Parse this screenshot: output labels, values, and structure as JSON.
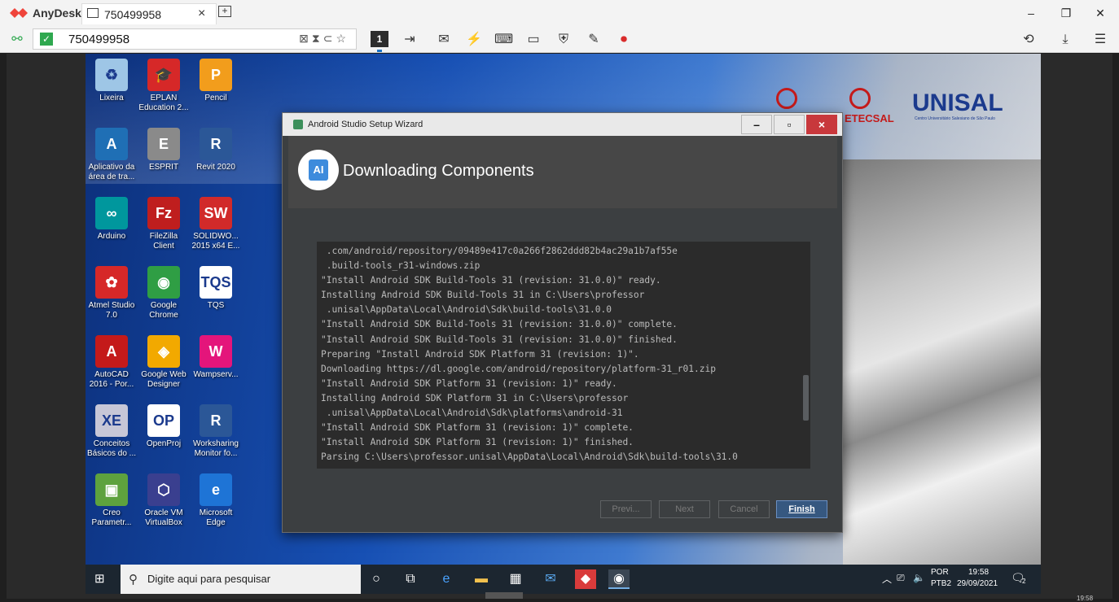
{
  "anydesk": {
    "app_name": "AnyDesk",
    "tab_label": "750499958",
    "tab_close": "×",
    "address_value": "750499958",
    "session_number": "1",
    "window_controls": [
      "–",
      "❐",
      "✕"
    ]
  },
  "desktop_icons": [
    {
      "label": "Lixeira",
      "icon": "recycle-bin-icon",
      "glyph": "♻",
      "color": "#9ec6e6"
    },
    {
      "label": "EPLAN\nEducation 2...",
      "icon": "eplan-icon",
      "glyph": "🎓",
      "color": "#d62828"
    },
    {
      "label": "Pencil",
      "icon": "pencil-icon",
      "glyph": "P",
      "color": "#f29d1c"
    },
    {
      "label": "Aplicativo da\nárea de tra...",
      "icon": "autodesk-app-icon",
      "glyph": "A",
      "color": "#1f6fb5"
    },
    {
      "label": "ESPRIT",
      "icon": "esprit-icon",
      "glyph": "E",
      "color": "#8a8a8a"
    },
    {
      "label": "Revit 2020",
      "icon": "revit-icon",
      "glyph": "R",
      "color": "#2b5797"
    },
    {
      "label": "Arduino",
      "icon": "arduino-icon",
      "glyph": "∞",
      "color": "#00979d"
    },
    {
      "label": "FileZilla\nClient",
      "icon": "filezilla-icon",
      "glyph": "Fz",
      "color": "#bf1e1e"
    },
    {
      "label": "SOLIDWO...\n2015 x64 E...",
      "icon": "solidworks-icon",
      "glyph": "SW",
      "color": "#d12a2a"
    },
    {
      "label": "Atmel Studio\n7.0",
      "icon": "atmel-icon",
      "glyph": "✿",
      "color": "#d62828"
    },
    {
      "label": "Google\nChrome",
      "icon": "chrome-icon",
      "glyph": "◉",
      "color": "#2f9e44"
    },
    {
      "label": "TQS",
      "icon": "tqs-icon",
      "glyph": "TQS",
      "color": "#ffffff"
    },
    {
      "label": "AutoCAD\n2016 - Por...",
      "icon": "autocad-icon",
      "glyph": "A",
      "color": "#c41a1a"
    },
    {
      "label": "Google Web\nDesigner",
      "icon": "web-designer-icon",
      "glyph": "◈",
      "color": "#f2a900"
    },
    {
      "label": "Wampserv...",
      "icon": "wampserver-icon",
      "glyph": "W",
      "color": "#e4157b"
    },
    {
      "label": "Conceitos\nBásicos do ...",
      "icon": "database-icon",
      "glyph": "XE",
      "color": "#c7c7d7"
    },
    {
      "label": "OpenProj",
      "icon": "openproj-icon",
      "glyph": "OP",
      "color": "#ffffff"
    },
    {
      "label": "Worksharing\nMonitor fo...",
      "icon": "worksharing-icon",
      "glyph": "R",
      "color": "#2b5797"
    },
    {
      "label": "Creo\nParametr...",
      "icon": "creo-icon",
      "glyph": "▣",
      "color": "#5ea23e"
    },
    {
      "label": "Oracle VM\nVirtualBox",
      "icon": "virtualbox-icon",
      "glyph": "⬡",
      "color": "#3a3f8f"
    },
    {
      "label": "Microsoft\nEdge",
      "icon": "edge-icon",
      "glyph": "e",
      "color": "#1e74d6"
    }
  ],
  "wallpaper": {
    "logo_main": "UNISAL",
    "logo_main_sub": "Centro Universitário Salesiano de São Paulo",
    "logo_second": "ETECSAL"
  },
  "wizard": {
    "window_title": "Android Studio Setup Wizard",
    "heading": "Downloading Components",
    "console_lines": [
      " .com/android/repository/09489e417c0a266f2862ddd82b4ac29a1b7af55e",
      " .build-tools_r31-windows.zip",
      "\"Install Android SDK Build-Tools 31 (revision: 31.0.0)\" ready.",
      "Installing Android SDK Build-Tools 31 in C:\\Users\\professor",
      " .unisal\\AppData\\Local\\Android\\Sdk\\build-tools\\31.0.0",
      "\"Install Android SDK Build-Tools 31 (revision: 31.0.0)\" complete.",
      "\"Install Android SDK Build-Tools 31 (revision: 31.0.0)\" finished.",
      "Preparing \"Install Android SDK Platform 31 (revision: 1)\".",
      "Downloading https://dl.google.com/android/repository/platform-31_r01.zip",
      "\"Install Android SDK Platform 31 (revision: 1)\" ready.",
      "Installing Android SDK Platform 31 in C:\\Users\\professor",
      " .unisal\\AppData\\Local\\Android\\Sdk\\platforms\\android-31",
      "\"Install Android SDK Platform 31 (revision: 1)\" complete.",
      "\"Install Android SDK Platform 31 (revision: 1)\" finished.",
      "Parsing C:\\Users\\professor.unisal\\AppData\\Local\\Android\\Sdk\\build-tools\\31.0"
    ],
    "buttons": {
      "previous": "Previ...",
      "next": "Next",
      "cancel": "Cancel",
      "finish": "Finish"
    }
  },
  "taskbar": {
    "search_placeholder": "Digite aqui para pesquisar",
    "language": "POR",
    "keyboard": "PTB2",
    "time": "19:58",
    "date": "29/09/2021",
    "notifications": "2"
  },
  "remote_clock": "19:58"
}
